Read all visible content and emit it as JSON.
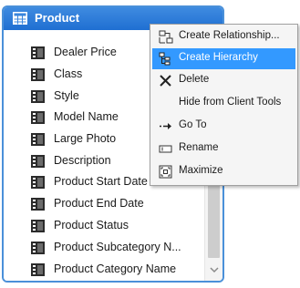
{
  "table": {
    "title": "Product",
    "columns": [
      "Dealer Price",
      "Class",
      "Style",
      "Model Name",
      "Large Photo",
      "Description",
      "Product Start Date",
      "Product End Date",
      "Product Status",
      "Product Subcategory N...",
      "Product Category Name"
    ]
  },
  "context_menu": {
    "items": [
      {
        "label": "Create Relationship...",
        "icon": "create-relationship-icon"
      },
      {
        "label": "Create Hierarchy",
        "icon": "create-hierarchy-icon",
        "highlighted": true
      },
      {
        "label": "Delete",
        "icon": "delete-icon"
      },
      {
        "label": "Hide from Client Tools",
        "icon": ""
      },
      {
        "label": "Go To",
        "icon": "go-to-icon"
      },
      {
        "label": "Rename",
        "icon": "rename-icon"
      },
      {
        "label": "Maximize",
        "icon": "maximize-icon"
      }
    ]
  },
  "colors": {
    "header": "#2a7de0",
    "highlight": "#3399ff",
    "border": "#4a90d9"
  }
}
